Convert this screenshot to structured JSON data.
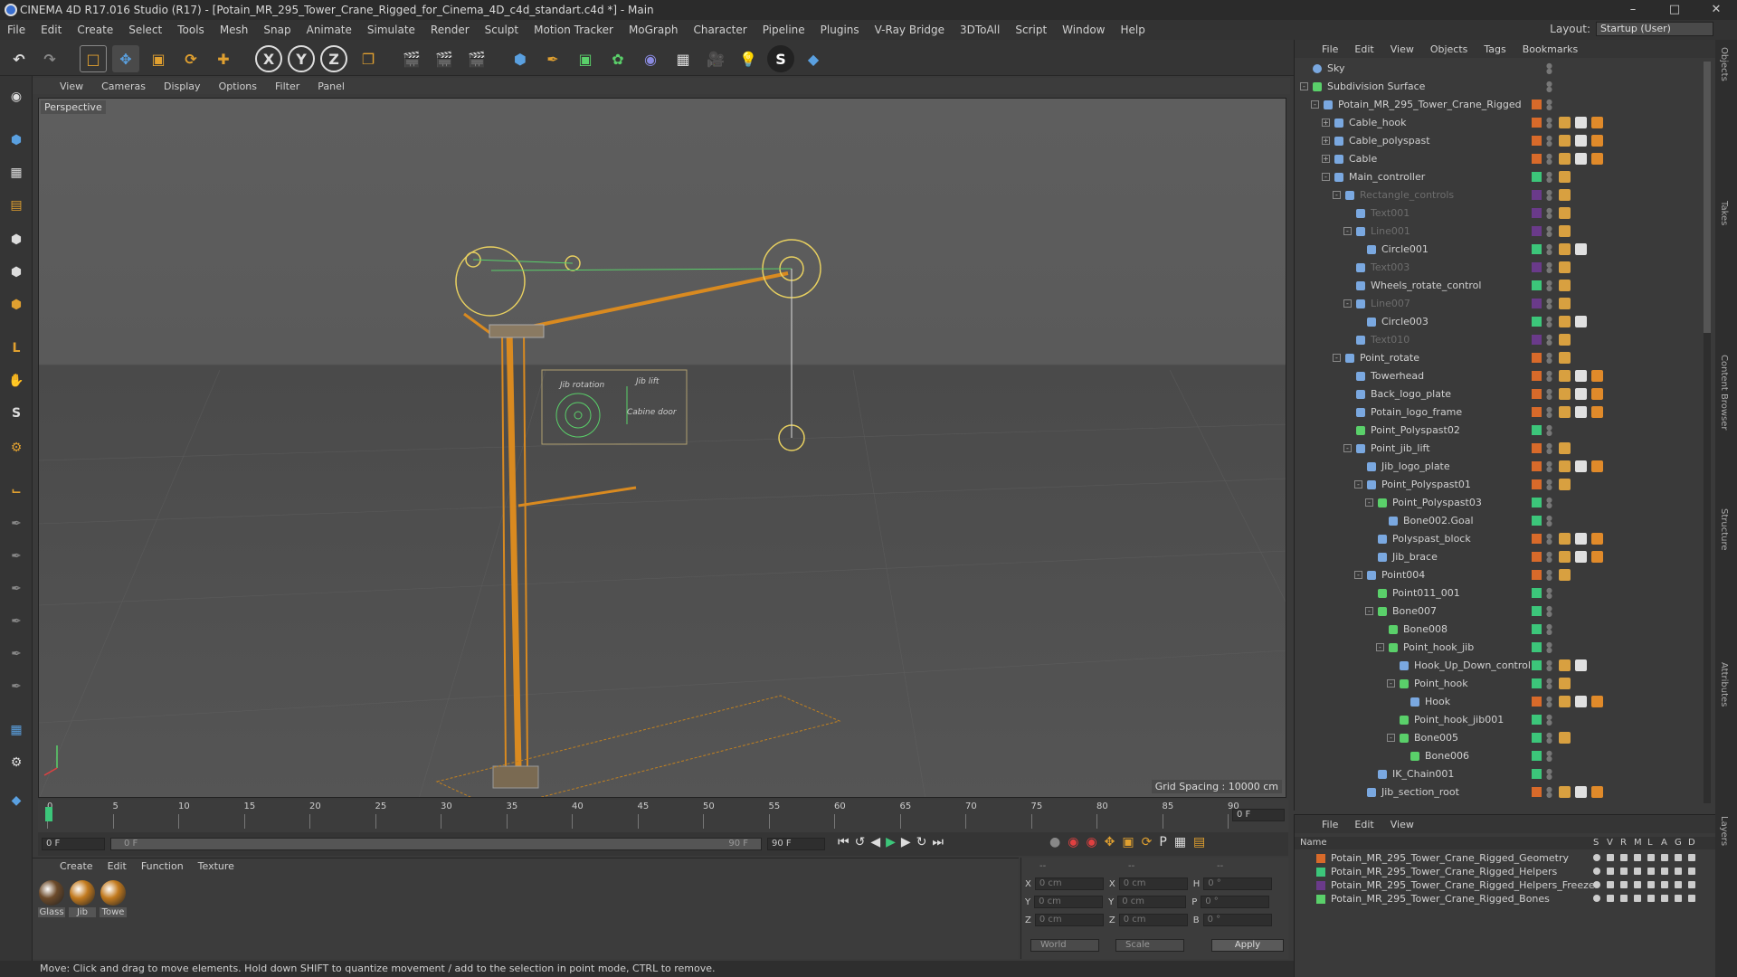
{
  "title": "CINEMA 4D R17.016 Studio (R17) - [Potain_MR_295_Tower_Crane_Rigged_for_Cinema_4D_c4d_standart.c4d *] - Main",
  "menu": [
    "File",
    "Edit",
    "Create",
    "Select",
    "Tools",
    "Mesh",
    "Snap",
    "Animate",
    "Simulate",
    "Render",
    "Sculpt",
    "Motion Tracker",
    "MoGraph",
    "Character",
    "Pipeline",
    "Plugins",
    "V-Ray Bridge",
    "3DToAll",
    "Script",
    "Window",
    "Help"
  ],
  "layout_label": "Layout:",
  "layout_value": "Startup (User)",
  "viewport_menu": [
    "View",
    "Cameras",
    "Display",
    "Options",
    "Filter",
    "Panel"
  ],
  "viewport_label": "Perspective",
  "grid_spacing": "Grid Spacing : 10000 cm",
  "viewport_overlay": {
    "jib_rotation": "Jib rotation",
    "jib_lift": "Jib lift",
    "cabine_door": "Cabine door"
  },
  "timeline_ticks": [
    "0",
    "5",
    "10",
    "15",
    "20",
    "25",
    "30",
    "35",
    "40",
    "45",
    "50",
    "55",
    "60",
    "65",
    "70",
    "75",
    "80",
    "85",
    "90"
  ],
  "frame_right": "0 F",
  "play": {
    "start": "0 F",
    "slider_start": "0 F",
    "slider_end": "90 F",
    "end": "90 F"
  },
  "material_menu": [
    "Create",
    "Edit",
    "Function",
    "Texture"
  ],
  "materials": [
    {
      "name": "Glass",
      "color": "#6c4a2a"
    },
    {
      "name": "Jib",
      "color": "#c27a1e"
    },
    {
      "name": "Towe",
      "color": "#c27a1e"
    }
  ],
  "coords": {
    "header": [
      "--",
      "--",
      "--"
    ],
    "rows": [
      {
        "a": "X",
        "av": "0 cm",
        "b": "X",
        "bv": "0 cm",
        "c": "H",
        "cv": "0 °"
      },
      {
        "a": "Y",
        "av": "0 cm",
        "b": "Y",
        "bv": "0 cm",
        "c": "P",
        "cv": "0 °"
      },
      {
        "a": "Z",
        "av": "0 cm",
        "b": "Z",
        "bv": "0 cm",
        "c": "B",
        "cv": "0 °"
      }
    ],
    "world": "World",
    "scale": "Scale",
    "apply": "Apply"
  },
  "status": "Move: Click and drag to move elements. Hold down SHIFT to quantize movement / add to the selection in point mode, CTRL to remove.",
  "object_menu": [
    "File",
    "Edit",
    "View",
    "Objects",
    "Tags",
    "Bookmarks"
  ],
  "objects": [
    {
      "name": "Sky",
      "lvl": 0,
      "exp": "",
      "dim": false,
      "layer": "",
      "icon": "sky",
      "tags": 0
    },
    {
      "name": "Subdivision Surface",
      "lvl": 0,
      "exp": "-",
      "dim": false,
      "layer": "",
      "icon": "subd",
      "tags": 0
    },
    {
      "name": "Potain_MR_295_Tower_Crane_Rigged",
      "lvl": 1,
      "exp": "-",
      "dim": false,
      "layer": "#d86a2a",
      "icon": "null",
      "tags": 0
    },
    {
      "name": "Cable_hook",
      "lvl": 2,
      "exp": "+",
      "dim": false,
      "layer": "#d86a2a",
      "icon": "poly",
      "tags": 3
    },
    {
      "name": "Cable_polyspast",
      "lvl": 2,
      "exp": "+",
      "dim": false,
      "layer": "#d86a2a",
      "icon": "poly",
      "tags": 3
    },
    {
      "name": "Cable",
      "lvl": 2,
      "exp": "+",
      "dim": false,
      "layer": "#d86a2a",
      "icon": "poly",
      "tags": 3
    },
    {
      "name": "Main_controller",
      "lvl": 2,
      "exp": "-",
      "dim": false,
      "layer": "#3cc67a",
      "icon": "poly",
      "tags": 1
    },
    {
      "name": "Rectangle_controls",
      "lvl": 3,
      "exp": "-",
      "dim": true,
      "layer": "#6a3a8a",
      "icon": "poly",
      "tags": 1
    },
    {
      "name": "Text001",
      "lvl": 4,
      "exp": "",
      "dim": true,
      "layer": "#6a3a8a",
      "icon": "poly",
      "tags": 1
    },
    {
      "name": "Line001",
      "lvl": 4,
      "exp": "-",
      "dim": true,
      "layer": "#6a3a8a",
      "icon": "poly",
      "tags": 1
    },
    {
      "name": "Circle001",
      "lvl": 5,
      "exp": "",
      "dim": false,
      "layer": "#3cc67a",
      "icon": "poly",
      "tags": 2
    },
    {
      "name": "Text003",
      "lvl": 4,
      "exp": "",
      "dim": true,
      "layer": "#6a3a8a",
      "icon": "poly",
      "tags": 1
    },
    {
      "name": "Wheels_rotate_control",
      "lvl": 4,
      "exp": "",
      "dim": false,
      "layer": "#3cc67a",
      "icon": "poly",
      "tags": 1
    },
    {
      "name": "Line007",
      "lvl": 4,
      "exp": "-",
      "dim": true,
      "layer": "#6a3a8a",
      "icon": "poly",
      "tags": 1
    },
    {
      "name": "Circle003",
      "lvl": 5,
      "exp": "",
      "dim": false,
      "layer": "#3cc67a",
      "icon": "poly",
      "tags": 2
    },
    {
      "name": "Text010",
      "lvl": 4,
      "exp": "",
      "dim": true,
      "layer": "#6a3a8a",
      "icon": "poly",
      "tags": 1
    },
    {
      "name": "Point_rotate",
      "lvl": 3,
      "exp": "-",
      "dim": false,
      "layer": "#d86a2a",
      "icon": "null",
      "tags": 1
    },
    {
      "name": "Towerhead",
      "lvl": 4,
      "exp": "",
      "dim": false,
      "layer": "#d86a2a",
      "icon": "poly",
      "tags": 3
    },
    {
      "name": "Back_logo_plate",
      "lvl": 4,
      "exp": "",
      "dim": false,
      "layer": "#d86a2a",
      "icon": "poly",
      "tags": 3
    },
    {
      "name": "Potain_logo_frame",
      "lvl": 4,
      "exp": "",
      "dim": false,
      "layer": "#d86a2a",
      "icon": "poly",
      "tags": 3
    },
    {
      "name": "Point_Polyspast02",
      "lvl": 4,
      "exp": "",
      "dim": false,
      "layer": "#3cc67a",
      "icon": "bone",
      "tags": 0
    },
    {
      "name": "Point_jib_lift",
      "lvl": 4,
      "exp": "-",
      "dim": false,
      "layer": "#d86a2a",
      "icon": "null",
      "tags": 1
    },
    {
      "name": "Jib_logo_plate",
      "lvl": 5,
      "exp": "",
      "dim": false,
      "layer": "#d86a2a",
      "icon": "poly",
      "tags": 3
    },
    {
      "name": "Point_Polyspast01",
      "lvl": 5,
      "exp": "-",
      "dim": false,
      "layer": "#d86a2a",
      "icon": "null",
      "tags": 1
    },
    {
      "name": "Point_Polyspast03",
      "lvl": 6,
      "exp": "-",
      "dim": false,
      "layer": "#3cc67a",
      "icon": "bone",
      "tags": 0
    },
    {
      "name": "Bone002.Goal",
      "lvl": 7,
      "exp": "",
      "dim": false,
      "layer": "#3cc67a",
      "icon": "null",
      "tags": 0
    },
    {
      "name": "Polyspast_block",
      "lvl": 6,
      "exp": "",
      "dim": false,
      "layer": "#d86a2a",
      "icon": "poly",
      "tags": 3
    },
    {
      "name": "Jib_brace",
      "lvl": 6,
      "exp": "",
      "dim": false,
      "layer": "#d86a2a",
      "icon": "poly",
      "tags": 3
    },
    {
      "name": "Point004",
      "lvl": 5,
      "exp": "-",
      "dim": false,
      "layer": "#d86a2a",
      "icon": "null",
      "tags": 1
    },
    {
      "name": "Point011_001",
      "lvl": 6,
      "exp": "",
      "dim": false,
      "layer": "#3cc67a",
      "icon": "bone",
      "tags": 0
    },
    {
      "name": "Bone007",
      "lvl": 6,
      "exp": "-",
      "dim": false,
      "layer": "#3cc67a",
      "icon": "bone",
      "tags": 0
    },
    {
      "name": "Bone008",
      "lvl": 7,
      "exp": "",
      "dim": false,
      "layer": "#3cc67a",
      "icon": "bone",
      "tags": 0
    },
    {
      "name": "Point_hook_jib",
      "lvl": 7,
      "exp": "-",
      "dim": false,
      "layer": "#3cc67a",
      "icon": "bone",
      "tags": 0
    },
    {
      "name": "Hook_Up_Down_control",
      "lvl": 8,
      "exp": "",
      "dim": false,
      "layer": "#3cc67a",
      "icon": "poly",
      "tags": 2
    },
    {
      "name": "Point_hook",
      "lvl": 8,
      "exp": "-",
      "dim": false,
      "layer": "#3cc67a",
      "icon": "bone",
      "tags": 1
    },
    {
      "name": "Hook",
      "lvl": 9,
      "exp": "",
      "dim": false,
      "layer": "#d86a2a",
      "icon": "poly",
      "tags": 3
    },
    {
      "name": "Point_hook_jib001",
      "lvl": 8,
      "exp": "",
      "dim": false,
      "layer": "#3cc67a",
      "icon": "bone",
      "tags": 0
    },
    {
      "name": "Bone005",
      "lvl": 8,
      "exp": "-",
      "dim": false,
      "layer": "#3cc67a",
      "icon": "bone",
      "tags": 1
    },
    {
      "name": "Bone006",
      "lvl": 9,
      "exp": "",
      "dim": false,
      "layer": "#3cc67a",
      "icon": "bone",
      "tags": 0
    },
    {
      "name": "IK_Chain001",
      "lvl": 6,
      "exp": "",
      "dim": false,
      "layer": "#3cc67a",
      "icon": "null",
      "tags": 0
    },
    {
      "name": "Jib_section_root",
      "lvl": 5,
      "exp": "",
      "dim": false,
      "layer": "#d86a2a",
      "icon": "poly",
      "tags": 3
    }
  ],
  "layer_menu": [
    "File",
    "Edit",
    "View"
  ],
  "layer_header": {
    "name": "Name",
    "cols": [
      "S",
      "V",
      "R",
      "M",
      "L",
      "A",
      "G",
      "D"
    ]
  },
  "layers": [
    {
      "name": "Potain_MR_295_Tower_Crane_Rigged_Geometry",
      "color": "#d86a2a"
    },
    {
      "name": "Potain_MR_295_Tower_Crane_Rigged_Helpers",
      "color": "#3cc67a"
    },
    {
      "name": "Potain_MR_295_Tower_Crane_Rigged_Helpers_Freeze",
      "color": "#6a3a8a"
    },
    {
      "name": "Potain_MR_295_Tower_Crane_Rigged_Bones",
      "color": "#5ad06a"
    }
  ],
  "side_tabs": [
    "Objects",
    "Takes",
    "Content Browser",
    "Structure",
    "Attributes",
    "Layers"
  ]
}
